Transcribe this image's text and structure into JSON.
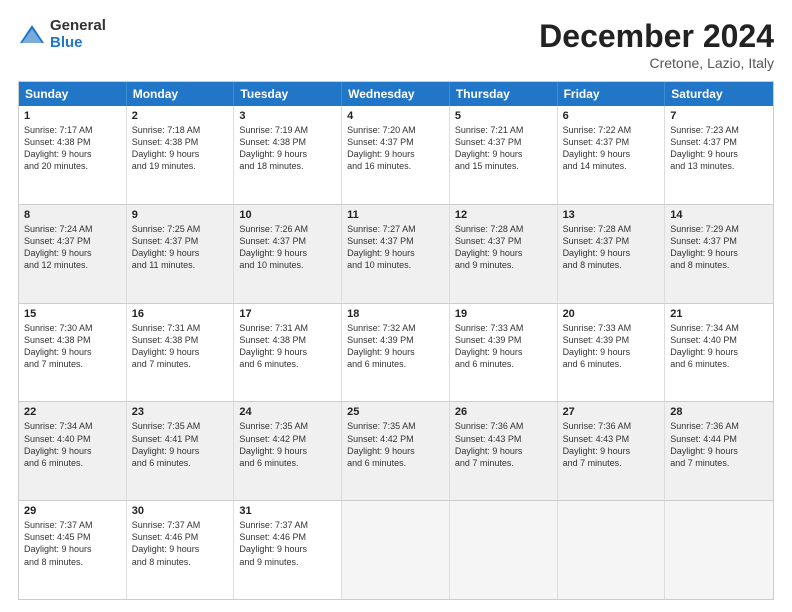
{
  "header": {
    "logo_general": "General",
    "logo_blue": "Blue",
    "title": "December 2024",
    "location": "Cretone, Lazio, Italy"
  },
  "days_of_week": [
    "Sunday",
    "Monday",
    "Tuesday",
    "Wednesday",
    "Thursday",
    "Friday",
    "Saturday"
  ],
  "weeks": [
    [
      {
        "day": "1",
        "lines": [
          "Sunrise: 7:17 AM",
          "Sunset: 4:38 PM",
          "Daylight: 9 hours",
          "and 20 minutes."
        ],
        "shaded": false
      },
      {
        "day": "2",
        "lines": [
          "Sunrise: 7:18 AM",
          "Sunset: 4:38 PM",
          "Daylight: 9 hours",
          "and 19 minutes."
        ],
        "shaded": false
      },
      {
        "day": "3",
        "lines": [
          "Sunrise: 7:19 AM",
          "Sunset: 4:38 PM",
          "Daylight: 9 hours",
          "and 18 minutes."
        ],
        "shaded": false
      },
      {
        "day": "4",
        "lines": [
          "Sunrise: 7:20 AM",
          "Sunset: 4:37 PM",
          "Daylight: 9 hours",
          "and 16 minutes."
        ],
        "shaded": false
      },
      {
        "day": "5",
        "lines": [
          "Sunrise: 7:21 AM",
          "Sunset: 4:37 PM",
          "Daylight: 9 hours",
          "and 15 minutes."
        ],
        "shaded": false
      },
      {
        "day": "6",
        "lines": [
          "Sunrise: 7:22 AM",
          "Sunset: 4:37 PM",
          "Daylight: 9 hours",
          "and 14 minutes."
        ],
        "shaded": false
      },
      {
        "day": "7",
        "lines": [
          "Sunrise: 7:23 AM",
          "Sunset: 4:37 PM",
          "Daylight: 9 hours",
          "and 13 minutes."
        ],
        "shaded": false
      }
    ],
    [
      {
        "day": "8",
        "lines": [
          "Sunrise: 7:24 AM",
          "Sunset: 4:37 PM",
          "Daylight: 9 hours",
          "and 12 minutes."
        ],
        "shaded": true
      },
      {
        "day": "9",
        "lines": [
          "Sunrise: 7:25 AM",
          "Sunset: 4:37 PM",
          "Daylight: 9 hours",
          "and 11 minutes."
        ],
        "shaded": true
      },
      {
        "day": "10",
        "lines": [
          "Sunrise: 7:26 AM",
          "Sunset: 4:37 PM",
          "Daylight: 9 hours",
          "and 10 minutes."
        ],
        "shaded": true
      },
      {
        "day": "11",
        "lines": [
          "Sunrise: 7:27 AM",
          "Sunset: 4:37 PM",
          "Daylight: 9 hours",
          "and 10 minutes."
        ],
        "shaded": true
      },
      {
        "day": "12",
        "lines": [
          "Sunrise: 7:28 AM",
          "Sunset: 4:37 PM",
          "Daylight: 9 hours",
          "and 9 minutes."
        ],
        "shaded": true
      },
      {
        "day": "13",
        "lines": [
          "Sunrise: 7:28 AM",
          "Sunset: 4:37 PM",
          "Daylight: 9 hours",
          "and 8 minutes."
        ],
        "shaded": true
      },
      {
        "day": "14",
        "lines": [
          "Sunrise: 7:29 AM",
          "Sunset: 4:37 PM",
          "Daylight: 9 hours",
          "and 8 minutes."
        ],
        "shaded": true
      }
    ],
    [
      {
        "day": "15",
        "lines": [
          "Sunrise: 7:30 AM",
          "Sunset: 4:38 PM",
          "Daylight: 9 hours",
          "and 7 minutes."
        ],
        "shaded": false
      },
      {
        "day": "16",
        "lines": [
          "Sunrise: 7:31 AM",
          "Sunset: 4:38 PM",
          "Daylight: 9 hours",
          "and 7 minutes."
        ],
        "shaded": false
      },
      {
        "day": "17",
        "lines": [
          "Sunrise: 7:31 AM",
          "Sunset: 4:38 PM",
          "Daylight: 9 hours",
          "and 6 minutes."
        ],
        "shaded": false
      },
      {
        "day": "18",
        "lines": [
          "Sunrise: 7:32 AM",
          "Sunset: 4:39 PM",
          "Daylight: 9 hours",
          "and 6 minutes."
        ],
        "shaded": false
      },
      {
        "day": "19",
        "lines": [
          "Sunrise: 7:33 AM",
          "Sunset: 4:39 PM",
          "Daylight: 9 hours",
          "and 6 minutes."
        ],
        "shaded": false
      },
      {
        "day": "20",
        "lines": [
          "Sunrise: 7:33 AM",
          "Sunset: 4:39 PM",
          "Daylight: 9 hours",
          "and 6 minutes."
        ],
        "shaded": false
      },
      {
        "day": "21",
        "lines": [
          "Sunrise: 7:34 AM",
          "Sunset: 4:40 PM",
          "Daylight: 9 hours",
          "and 6 minutes."
        ],
        "shaded": false
      }
    ],
    [
      {
        "day": "22",
        "lines": [
          "Sunrise: 7:34 AM",
          "Sunset: 4:40 PM",
          "Daylight: 9 hours",
          "and 6 minutes."
        ],
        "shaded": true
      },
      {
        "day": "23",
        "lines": [
          "Sunrise: 7:35 AM",
          "Sunset: 4:41 PM",
          "Daylight: 9 hours",
          "and 6 minutes."
        ],
        "shaded": true
      },
      {
        "day": "24",
        "lines": [
          "Sunrise: 7:35 AM",
          "Sunset: 4:42 PM",
          "Daylight: 9 hours",
          "and 6 minutes."
        ],
        "shaded": true
      },
      {
        "day": "25",
        "lines": [
          "Sunrise: 7:35 AM",
          "Sunset: 4:42 PM",
          "Daylight: 9 hours",
          "and 6 minutes."
        ],
        "shaded": true
      },
      {
        "day": "26",
        "lines": [
          "Sunrise: 7:36 AM",
          "Sunset: 4:43 PM",
          "Daylight: 9 hours",
          "and 7 minutes."
        ],
        "shaded": true
      },
      {
        "day": "27",
        "lines": [
          "Sunrise: 7:36 AM",
          "Sunset: 4:43 PM",
          "Daylight: 9 hours",
          "and 7 minutes."
        ],
        "shaded": true
      },
      {
        "day": "28",
        "lines": [
          "Sunrise: 7:36 AM",
          "Sunset: 4:44 PM",
          "Daylight: 9 hours",
          "and 7 minutes."
        ],
        "shaded": true
      }
    ],
    [
      {
        "day": "29",
        "lines": [
          "Sunrise: 7:37 AM",
          "Sunset: 4:45 PM",
          "Daylight: 9 hours",
          "and 8 minutes."
        ],
        "shaded": false
      },
      {
        "day": "30",
        "lines": [
          "Sunrise: 7:37 AM",
          "Sunset: 4:46 PM",
          "Daylight: 9 hours",
          "and 8 minutes."
        ],
        "shaded": false
      },
      {
        "day": "31",
        "lines": [
          "Sunrise: 7:37 AM",
          "Sunset: 4:46 PM",
          "Daylight: 9 hours",
          "and 9 minutes."
        ],
        "shaded": false
      },
      {
        "day": "",
        "lines": [],
        "shaded": false,
        "empty": true
      },
      {
        "day": "",
        "lines": [],
        "shaded": false,
        "empty": true
      },
      {
        "day": "",
        "lines": [],
        "shaded": false,
        "empty": true
      },
      {
        "day": "",
        "lines": [],
        "shaded": false,
        "empty": true
      }
    ]
  ]
}
